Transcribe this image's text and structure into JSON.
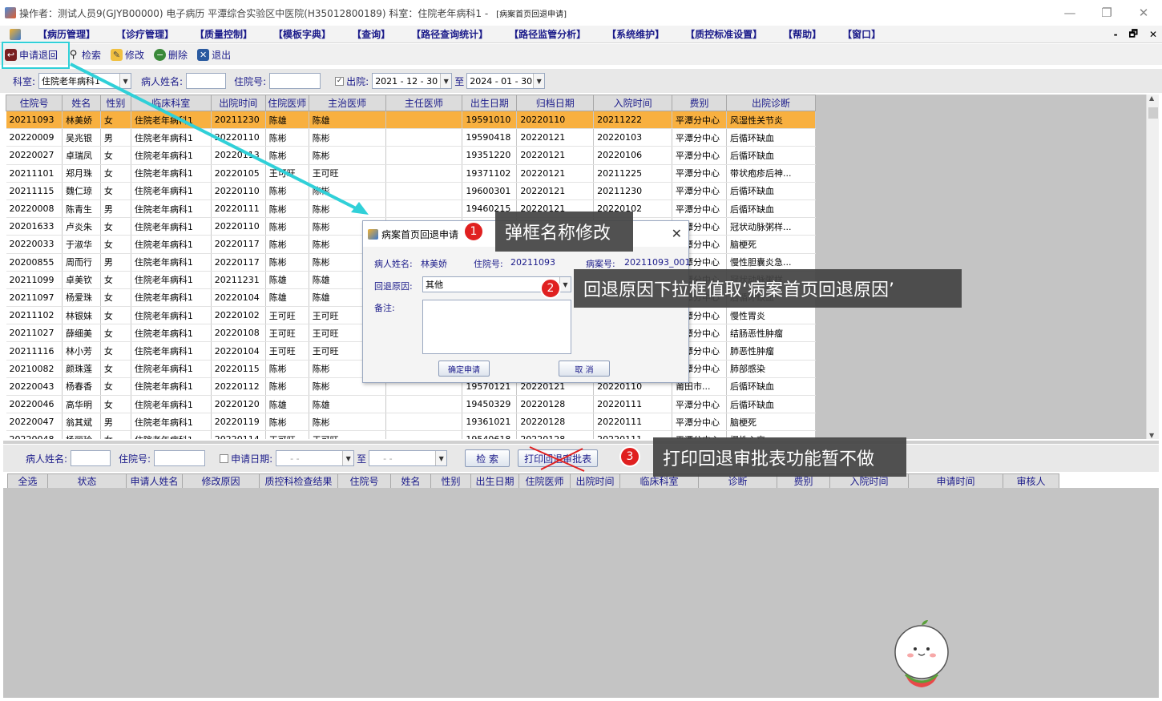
{
  "titlebar": {
    "text": "操作者：测试人员9(GJYB00000) 电子病历  平潭综合实验区中医院(H35012800189)  科室：住院老年病科1 -",
    "subtitle": "[病案首页回退申请]",
    "min_icon": "—",
    "max_icon": "❐",
    "close_icon": "✕"
  },
  "menu": {
    "items": [
      "【病历管理】",
      "【诊疗管理】",
      "【质量控制】",
      "【模板字典】",
      "【查询】",
      "【路径查询统计】",
      "【路径监管分析】",
      "【系统维护】",
      "【质控标准设置】",
      "【帮助】",
      "【窗口】"
    ],
    "ctl_min": "-",
    "ctl_restore": "🗗",
    "ctl_close": "✕"
  },
  "toolbar": {
    "apply_return": "申请退回",
    "search": "检索",
    "edit": "修改",
    "delete": "删除",
    "exit": "退出"
  },
  "filter1": {
    "dept_label": "科室:",
    "dept_value": "住院老年病科1",
    "patient_label": "病人姓名:",
    "patient_value": "",
    "inpatient_label": "住院号:",
    "inpatient_value": "",
    "discharge_label": "出院:",
    "date_from": "2021 - 12 - 30",
    "to_label": "至",
    "date_to": "2024 - 01 - 30"
  },
  "grid1": {
    "columns": [
      "住院号",
      "姓名",
      "性别",
      "临床科室",
      "出院时间",
      "住院医师",
      "主治医师",
      "主任医师",
      "出生日期",
      "归档日期",
      "入院时间",
      "费别",
      "出院诊断"
    ],
    "rows": [
      [
        "20211093",
        "林美娇",
        "女",
        "住院老年病科1",
        "20211230",
        "陈雄",
        "陈雄",
        "",
        "19591010",
        "20220110",
        "20211222",
        "平潭分中心",
        "风湿性关节炎"
      ],
      [
        "20220009",
        "吴兆银",
        "男",
        "住院老年病科1",
        "20220110",
        "陈彬",
        "陈彬",
        "",
        "19590418",
        "20220121",
        "20220103",
        "平潭分中心",
        "后循环缺血"
      ],
      [
        "20220027",
        "卓瑞凤",
        "女",
        "住院老年病科1",
        "20220113",
        "陈彬",
        "陈彬",
        "",
        "19351220",
        "20220121",
        "20220106",
        "平潭分中心",
        "后循环缺血"
      ],
      [
        "20211101",
        "郑月珠",
        "女",
        "住院老年病科1",
        "20220105",
        "王可旺",
        "王可旺",
        "",
        "19371102",
        "20220121",
        "20211225",
        "平潭分中心",
        "带状疱疹后神..."
      ],
      [
        "20211115",
        "魏仁琼",
        "女",
        "住院老年病科1",
        "20220110",
        "陈彬",
        "陈彬",
        "",
        "19600301",
        "20220121",
        "20211230",
        "平潭分中心",
        "后循环缺血"
      ],
      [
        "20220008",
        "陈青生",
        "男",
        "住院老年病科1",
        "20220111",
        "陈彬",
        "陈彬",
        "",
        "19460215",
        "20220121",
        "20220102",
        "平潭分中心",
        "后循环缺血"
      ],
      [
        "20201633",
        "卢炎朱",
        "女",
        "住院老年病科1",
        "20220110",
        "陈彬",
        "陈彬",
        "",
        "",
        "",
        "",
        "平潭分中心",
        "冠状动脉粥样..."
      ],
      [
        "20220033",
        "于淑华",
        "女",
        "住院老年病科1",
        "20220117",
        "陈彬",
        "陈彬",
        "",
        "",
        "",
        "",
        "平潭分中心",
        "脑梗死"
      ],
      [
        "20200855",
        "周而行",
        "男",
        "住院老年病科1",
        "20220117",
        "陈彬",
        "陈彬",
        "",
        "",
        "",
        "",
        "平潭分中心",
        "慢性胆囊炎急..."
      ],
      [
        "20211099",
        "卓美钦",
        "女",
        "住院老年病科1",
        "20211231",
        "陈雄",
        "陈雄",
        "",
        "",
        "",
        "",
        "平潭分中心",
        "冠状动脉粥样..."
      ],
      [
        "20211097",
        "杨爱珠",
        "女",
        "住院老年病科1",
        "20220104",
        "陈雄",
        "陈雄",
        "",
        "",
        "",
        "",
        "平潭分中心",
        "后循环缺血"
      ],
      [
        "20211102",
        "林银妹",
        "女",
        "住院老年病科1",
        "20220102",
        "王可旺",
        "王可旺",
        "",
        "",
        "",
        "",
        "平潭分中心",
        "慢性胃炎"
      ],
      [
        "20211027",
        "薛细美",
        "女",
        "住院老年病科1",
        "20220108",
        "王可旺",
        "王可旺",
        "",
        "",
        "",
        "",
        "平潭分中心",
        "结肠恶性肿瘤"
      ],
      [
        "20211116",
        "林小芳",
        "女",
        "住院老年病科1",
        "20220104",
        "王可旺",
        "王可旺",
        "",
        "",
        "",
        "",
        "平潭分中心",
        "肺恶性肿瘤"
      ],
      [
        "20210082",
        "颜珠莲",
        "女",
        "住院老年病科1",
        "20220115",
        "陈彬",
        "陈彬",
        "",
        "",
        "",
        "",
        "平潭分中心",
        "肺部感染"
      ],
      [
        "20220043",
        "杨春香",
        "女",
        "住院老年病科1",
        "20220112",
        "陈彬",
        "陈彬",
        "",
        "19570121",
        "20220121",
        "20220110",
        "莆田市...",
        "后循环缺血"
      ],
      [
        "20220046",
        "高华明",
        "女",
        "住院老年病科1",
        "20220120",
        "陈雄",
        "陈雄",
        "",
        "19450329",
        "20220128",
        "20220111",
        "平潭分中心",
        "后循环缺血"
      ],
      [
        "20220047",
        "翁其斌",
        "男",
        "住院老年病科1",
        "20220119",
        "陈彬",
        "陈彬",
        "",
        "19361021",
        "20220128",
        "20220111",
        "平潭分中心",
        "脑梗死"
      ],
      [
        "20220048",
        "杨丽玲",
        "女",
        "住院老年病科1",
        "20220114",
        "王可旺",
        "王可旺",
        "",
        "19540618",
        "20220128",
        "20220111",
        "平潭分中心",
        "慢性心衰..."
      ]
    ]
  },
  "filter2": {
    "patient_label": "病人姓名:",
    "patient_value": "",
    "inpatient_label": "住院号:",
    "inpatient_value": "",
    "apply_date_label": "申请日期:",
    "date_from": "-   -",
    "to_label": "至",
    "date_to": "-   -",
    "search_btn": "检 索",
    "print_btn": "打印回退审批表"
  },
  "grid2": {
    "columns": [
      "全选",
      "状态",
      "申请人姓名",
      "修改原因",
      "质控科检查结果",
      "住院号",
      "姓名",
      "性别",
      "出生日期",
      "住院医师",
      "出院时间",
      "临床科室",
      "诊断",
      "费别",
      "入院时间",
      "申请时间",
      "审核人"
    ]
  },
  "dialog": {
    "title": "病案首页回退申请",
    "close_icon": "✕",
    "patient_label": "病人姓名:",
    "patient_value": "林美娇",
    "inpatient_label": "住院号:",
    "inpatient_value": "20211093",
    "case_label": "病案号:",
    "case_value": "20211093_001",
    "reason_label": "回退原因:",
    "reason_value": "其他",
    "note_label": "备注:",
    "note_value": "",
    "confirm_btn": "确定申请",
    "cancel_btn": "取  消"
  },
  "callouts": {
    "c1_num": "1",
    "c1_text": "弹框名称修改",
    "c2_num": "2",
    "c2_text": "回退原因下拉框值取‘病案首页回退原因’",
    "c3_num": "3",
    "c3_text": "打印回退审批表功能暂不做"
  },
  "colors": {
    "accent_cyan": "#30d0d8",
    "selected_row": "#f8b040",
    "callout_bg": "#444444",
    "badge_red": "#e02020",
    "label_blue": "#1b1b8a"
  }
}
